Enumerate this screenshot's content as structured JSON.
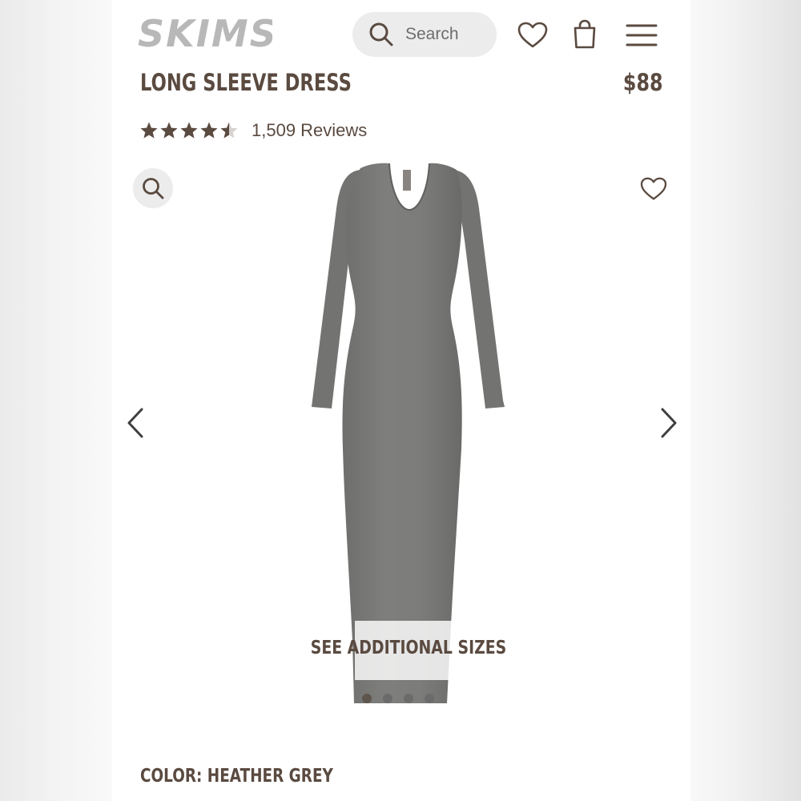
{
  "header": {
    "logo_text": "SKIMS",
    "search_placeholder": "Search",
    "icons": [
      "search-icon",
      "heart-icon",
      "shopping-bag-icon",
      "menu-icon"
    ]
  },
  "product": {
    "title": "LONG SLEEVE DRESS",
    "price": "$88",
    "rating_value": 4.5,
    "rating_max": 5,
    "reviews": "1,509 Reviews",
    "color_label": "COLOR:",
    "color_value": "HEATHER GREY"
  },
  "gallery": {
    "sizes_label": "SEE ADDITIONAL SIZES",
    "image_count": 4,
    "active_index": 0,
    "icons": [
      "zoom-icon",
      "heart-icon",
      "chevron-left-icon",
      "chevron-right-icon"
    ]
  },
  "colors": {
    "brand_text": "#5a4a40",
    "logo": "#b8b8b8",
    "search_bg": "#ececec",
    "dress": "#7a7a78"
  }
}
